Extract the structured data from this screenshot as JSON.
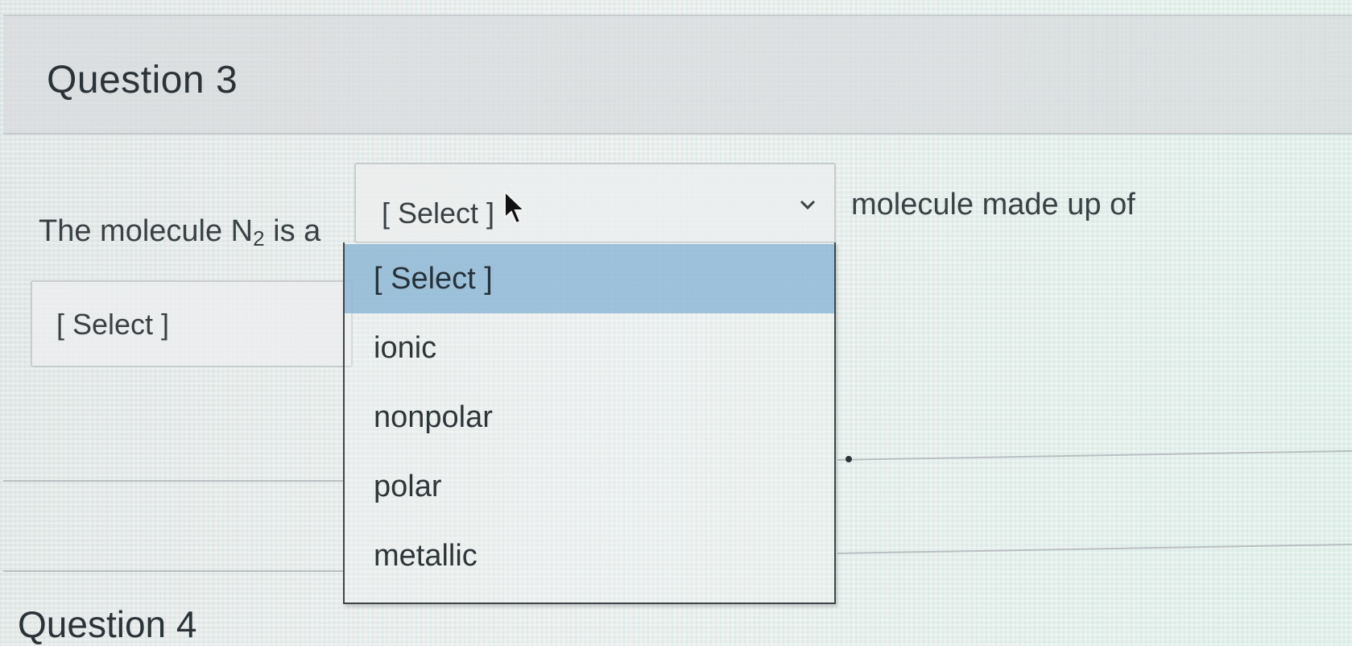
{
  "question3": {
    "title": "Question 3",
    "sentence_before": "The molecule N",
    "subscript": "2",
    "sentence_after_subscript": " is a",
    "sentence_after_select": "molecule made up of",
    "sentence_end": "."
  },
  "select1": {
    "value": "[ Select ]",
    "icon": "chevron-down-icon",
    "open": true,
    "options": [
      "[ Select ]",
      "ionic",
      "nonpolar",
      "polar",
      "metallic"
    ],
    "highlighted": "[ Select ]"
  },
  "select2": {
    "value": "[ Select ]"
  },
  "question4": {
    "title": "Question 4"
  }
}
